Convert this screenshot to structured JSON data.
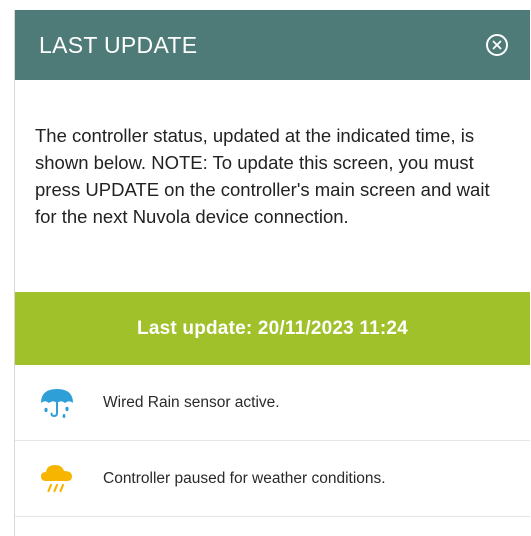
{
  "dialog": {
    "title": "LAST UPDATE",
    "close_icon": "close-circle-icon",
    "description": "The controller status, updated at the indicated time, is shown below. NOTE: To update this screen, you must press UPDATE on the controller's main screen and wait for the next Nuvola device connection.",
    "last_update_label": "Last update: 20/11/2023 11:24"
  },
  "statuses": [
    {
      "icon": "rain-umbrella-icon",
      "text": "Wired Rain sensor active."
    },
    {
      "icon": "weather-cloud-rain-icon",
      "text": "Controller paused for weather conditions."
    }
  ],
  "colors": {
    "header_bg": "#4e7a78",
    "banner_bg": "#a0c12a",
    "umbrella_blue": "#2f9fd8",
    "cloud_yellow": "#f7b500"
  }
}
